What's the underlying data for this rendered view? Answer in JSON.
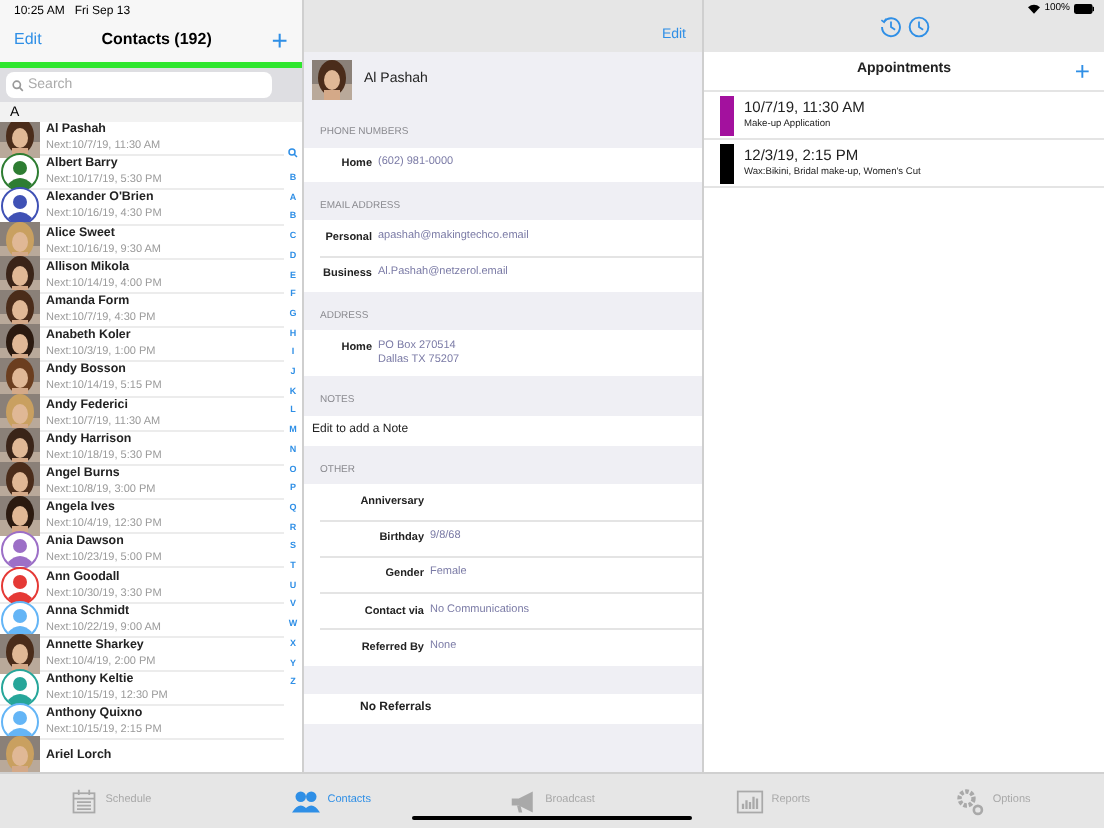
{
  "status_bar": {
    "time": "10:25 AM",
    "date": "Fri Sep 13",
    "battery": "100%"
  },
  "contacts": {
    "edit": "Edit",
    "title": "Contacts (192)",
    "add": "+",
    "search": {
      "placeholder": "Search"
    },
    "section": "A",
    "rows": [
      {
        "name": "Al Pashah",
        "next": "Next:10/7/19, 11:30 AM",
        "selected": false
      },
      {
        "name": "Albert Barry",
        "next": "Next:10/17/19, 5:30 PM",
        "kind": "silhouette",
        "color": "#2e7d32",
        "selected": false
      },
      {
        "name": "Alexander O'Brien",
        "next": "Next:10/16/19, 4:30 PM",
        "kind": "silhouette",
        "color": "#3f51b5",
        "selected": false
      },
      {
        "name": "Alice Sweet",
        "next": "Next:10/16/19, 9:30 AM",
        "selected": false
      },
      {
        "name": "Allison Mikola",
        "next": "Next:10/14/19, 4:00 PM",
        "selected": false
      },
      {
        "name": "Amanda Form",
        "next": "Next:10/7/19, 4:30 PM",
        "selected": false
      },
      {
        "name": "Anabeth Koler",
        "next": "Next:10/3/19, 1:00 PM",
        "selected": false
      },
      {
        "name": "Andy Bosson",
        "next": "Next:10/14/19, 5:15 PM",
        "selected": false
      },
      {
        "name": "Andy Federici",
        "next": "Next:10/7/19, 11:30 AM",
        "selected": false
      },
      {
        "name": "Andy Harrison",
        "next": "Next:10/18/19, 5:30 PM",
        "selected": false
      },
      {
        "name": "Angel Burns",
        "next": "Next:10/8/19, 3:00 PM",
        "selected": false
      },
      {
        "name": "Angela Ives",
        "next": "Next:10/4/19, 12:30 PM",
        "selected": false
      },
      {
        "name": "Ania Dawson",
        "next": "Next:10/23/19, 5:00 PM",
        "kind": "silhouette",
        "color": "#9c6fc7",
        "selected": false
      },
      {
        "name": "Ann Goodall",
        "next": "Next:10/30/19, 3:30 PM",
        "kind": "silhouette",
        "color": "#e53935",
        "selected": false
      },
      {
        "name": "Anna Schmidt",
        "next": "Next:10/22/19, 9:00 AM",
        "kind": "silhouette",
        "color": "#64b5f6",
        "selected": false
      },
      {
        "name": "Annette Sharkey",
        "next": "Next:10/4/19, 2:00 PM",
        "selected": false
      },
      {
        "name": "Anthony Keltie",
        "next": "Next:10/15/19, 12:30 PM",
        "kind": "silhouette",
        "color": "#26a69a",
        "selected": false
      },
      {
        "name": "Anthony Quixno",
        "next": "Next:10/15/19, 2:15 PM",
        "kind": "silhouette",
        "color": "#64b5f6",
        "selected": false
      },
      {
        "name": "Ariel Lorch",
        "selected": false
      }
    ],
    "index": [
      "B",
      "A",
      "B",
      "C",
      "D",
      "E",
      "F",
      "G",
      "H",
      "I",
      "J",
      "K",
      "L",
      "M",
      "N",
      "O",
      "P",
      "Q",
      "R",
      "S",
      "T",
      "U",
      "V",
      "W",
      "X",
      "Y",
      "Z"
    ]
  },
  "detail": {
    "edit": "Edit",
    "name": "Al Pashah",
    "sections": [
      {
        "header": "PHONE NUMBERS",
        "rows": [
          {
            "label": "Home",
            "value": "(602) 981-0000"
          }
        ]
      },
      {
        "header": "EMAIL ADDRESS",
        "rows": [
          {
            "label": "Personal",
            "value": "apashah@makingtechco.email"
          },
          {
            "label": "Business",
            "value": "Al.Pashah@netzerol.email"
          }
        ]
      },
      {
        "header": "ADDRESS",
        "rows": [
          {
            "label": "Home",
            "value": "PO Box 270514\nDallas TX 75207"
          }
        ]
      },
      {
        "header": "NOTES",
        "note": "Edit to add a Note"
      },
      {
        "header": "OTHER",
        "rows": [
          {
            "label": "Anniversary"
          },
          {
            "label": "Birthday",
            "value": "9/8/68"
          },
          {
            "label": "Gender",
            "value": "Female"
          },
          {
            "label": "Contact via",
            "value": "No Communications"
          },
          {
            "label": "Referred By",
            "value": "None"
          }
        ]
      }
    ],
    "referrals": "No Referrals"
  },
  "appointments": {
    "title": "Appointments",
    "add": "+",
    "items": [
      {
        "when": "10/7/19, 11:30 AM",
        "services": "Make-up Application",
        "color": "#a3119e"
      },
      {
        "when": "12/3/19, 2:15 PM",
        "services": "Wax:Bikini, Bridal make-up, Women's Cut",
        "color": "#000000"
      }
    ]
  },
  "tabs": [
    {
      "label": "Schedule",
      "kind": "calendar",
      "selected": false
    },
    {
      "label": "Contacts",
      "kind": "people",
      "selected": true
    },
    {
      "label": "Broadcast",
      "kind": "megaphone",
      "selected": false
    },
    {
      "label": "Reports",
      "kind": "chart",
      "selected": false
    },
    {
      "label": "Options",
      "kind": "gears",
      "selected": false
    }
  ]
}
